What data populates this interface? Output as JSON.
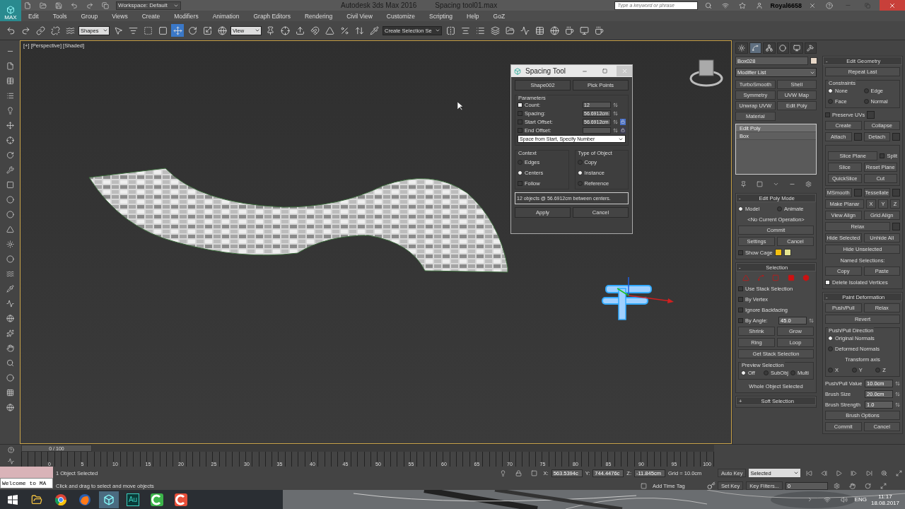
{
  "title_bar": {
    "app_label": "MAX",
    "workspace": "Workspace: Default",
    "title": "Autodesk 3ds Max 2016",
    "file": "Spacing tool01.max",
    "search_placeholder": "Type a keyword or phrase",
    "user": "Royal6658"
  },
  "menu": [
    "Edit",
    "Tools",
    "Group",
    "Views",
    "Create",
    "Modifiers",
    "Animation",
    "Graph Editors",
    "Rendering",
    "Civil View",
    "Customize",
    "Scripting",
    "Help",
    "GoZ"
  ],
  "toolbar": {
    "selection_filter": "Shapes",
    "reference_coordinate": "View",
    "named_selection": "Create Selection Se"
  },
  "viewport": {
    "label": "[+] [Perspective] [Shaded]",
    "active": true,
    "dialog": {
      "title": "Spacing Tool",
      "path_button": "Shape002",
      "points_button": "Pick Points",
      "parameters_title": "Parameters",
      "parameters": [
        {
          "kind": "spinner",
          "label": "Count:",
          "checked": true,
          "value": "12"
        },
        {
          "kind": "spinner",
          "label": "Spacing:",
          "checked": false,
          "value": "56.6912cm"
        },
        {
          "kind": "locked",
          "label": "Start Offset:",
          "checked": false,
          "value": "56.6912cm",
          "lock_on": true
        },
        {
          "kind": "locked",
          "label": "End Offset:",
          "checked": false,
          "lock_on": false
        }
      ],
      "mode": "Space from Start, Specify Number",
      "context_title": "Context",
      "context": [
        {
          "label": "Edges",
          "selected": false
        },
        {
          "label": "Centers",
          "selected": true
        }
      ],
      "follow": {
        "label": "Follow",
        "checked": false
      },
      "type_title": "Type of Object",
      "types": [
        {
          "label": "Copy",
          "selected": false
        },
        {
          "label": "Instance",
          "selected": true
        },
        {
          "label": "Reference",
          "selected": false
        }
      ],
      "summary": "12 objects @ 56.6912cm  between centers.",
      "apply": "Apply",
      "cancel": "Cancel"
    }
  },
  "panel": {
    "tabs": [
      {
        "selected": false
      },
      {
        "selected": true
      },
      {
        "selected": false
      },
      {
        "selected": false
      },
      {
        "selected": false
      },
      {
        "selected": false
      }
    ],
    "object_name": "Box028",
    "modifier_list": "Modifier List",
    "modifier_buttons": [
      "TurboSmooth",
      "Shell",
      "Symmetry",
      "UVW Map",
      "Unwrap UVW",
      "Edit Poly",
      "Material"
    ],
    "stack": [
      {
        "label": "Edit Poly",
        "selected": true
      },
      {
        "label": "Box",
        "selected": false
      }
    ],
    "rollouts_left": [
      {
        "sign": "-",
        "title": "Edit Poly Mode",
        "rows": [
          [
            {
              "kind": "radio",
              "label": "Model",
              "selected": true
            },
            {
              "kind": "radio",
              "label": "Animate",
              "selected": false
            }
          ],
          [
            {
              "kind": "text",
              "label": "<No Current Operation>"
            }
          ],
          [
            {
              "kind": "button",
              "label": "Commit"
            }
          ],
          [
            {
              "kind": "button",
              "label": "Settings"
            },
            {
              "kind": "button",
              "label": "Cancel"
            }
          ],
          [
            {
              "kind": "checkbox",
              "label": "Show Cage",
              "checked": false
            },
            {
              "kind": "swatch",
              "color": "#f5c010"
            },
            {
              "kind": "swatch",
              "color": "#e4e490"
            }
          ]
        ]
      },
      {
        "sign": "-",
        "title": "Selection",
        "rows": [
          [
            {
              "kind": "icons"
            }
          ],
          [
            {
              "kind": "checkbox",
              "label": "Use Stack Selection",
              "checked": false
            }
          ],
          [
            {
              "kind": "checkbox",
              "label": "By Vertex",
              "checked": false
            }
          ],
          [
            {
              "kind": "checkbox",
              "label": "Ignore Backfacing",
              "checked": false
            }
          ],
          [
            {
              "kind": "checkbox",
              "label": "By Angle:",
              "checked": false
            },
            {
              "kind": "spinner",
              "value": "45.0"
            }
          ],
          [
            {
              "kind": "button",
              "label": "Shrink"
            },
            {
              "kind": "button",
              "label": "Grow"
            }
          ],
          [
            {
              "kind": "button",
              "label": "Ring"
            },
            {
              "kind": "button",
              "label": "Loop"
            }
          ],
          [
            {
              "kind": "button",
              "label": "Get Stack Selection"
            }
          ],
          [
            {
              "kind": "group",
              "title": "Preview Selection",
              "rows": [
                [
                  {
                    "kind": "radio",
                    "label": "Off",
                    "selected": true
                  },
                  {
                    "kind": "radio",
                    "label": "SubObj",
                    "selected": false
                  },
                  {
                    "kind": "radio",
                    "label": "Multi",
                    "selected": false
                  }
                ]
              ]
            }
          ],
          [
            {
              "kind": "text",
              "label": "Whole Object Selected"
            }
          ]
        ]
      },
      {
        "sign": "+",
        "title": "Soft Selection"
      }
    ],
    "rollouts_right": [
      {
        "sign": "-",
        "title": "Edit Geometry",
        "rows": [
          [
            {
              "kind": "button",
              "label": "Repeat Last"
            }
          ],
          [
            {
              "kind": "group",
              "title": "Constraints",
              "rows": [
                [
                  {
                    "kind": "radio",
                    "label": "None",
                    "selected": true
                  },
                  {
                    "kind": "radio",
                    "label": "Edge",
                    "selected": false
                  }
                ],
                [
                  {
                    "kind": "radio",
                    "label": "Face",
                    "selected": false
                  },
                  {
                    "kind": "radio",
                    "label": "Normal",
                    "selected": false
                  }
                ]
              ]
            }
          ],
          [
            {
              "kind": "checkbox",
              "label": "Preserve UVs",
              "checked": false,
              "settings": true
            }
          ],
          [
            {
              "kind": "button",
              "label": "Create"
            },
            {
              "kind": "button",
              "label": "Collapse"
            }
          ],
          [
            {
              "kind": "button",
              "label": "Attach",
              "settings": true
            },
            {
              "kind": "button",
              "label": "Detach",
              "settings": true
            }
          ],
          [
            {
              "kind": "group",
              "rows": [
                [
                  {
                    "kind": "button",
                    "label": "Slice Plane"
                  },
                  {
                    "kind": "checkbox",
                    "label": "Split",
                    "checked": false
                  }
                ],
                [
                  {
                    "kind": "button",
                    "label": "Slice"
                  },
                  {
                    "kind": "button",
                    "label": "Reset Plane"
                  }
                ],
                [
                  {
                    "kind": "button",
                    "label": "QuickSlice"
                  },
                  {
                    "kind": "button",
                    "label": "Cut"
                  }
                ]
              ]
            }
          ],
          [
            {
              "kind": "button",
              "label": "MSmooth",
              "settings": true
            },
            {
              "kind": "button",
              "label": "Tessellate",
              "settings": true
            }
          ],
          [
            {
              "kind": "button",
              "label": "Make Planar"
            },
            {
              "kind": "small",
              "label": "X"
            },
            {
              "kind": "small",
              "label": "Y"
            },
            {
              "kind": "small",
              "label": "Z"
            }
          ],
          [
            {
              "kind": "button",
              "label": "View Align"
            },
            {
              "kind": "button",
              "label": "Grid Align"
            }
          ],
          [
            {
              "kind": "button",
              "label": "Relax",
              "settings": true
            }
          ],
          [
            {
              "kind": "button",
              "label": "Hide Selected"
            },
            {
              "kind": "button",
              "label": "Unhide All"
            }
          ],
          [
            {
              "kind": "button",
              "label": "Hide Unselected"
            }
          ],
          [
            {
              "kind": "text",
              "label": "Named Selections:"
            }
          ],
          [
            {
              "kind": "button",
              "label": "Copy"
            },
            {
              "kind": "button",
              "label": "Paste"
            }
          ],
          [
            {
              "kind": "checkbox",
              "label": "Delete Isolated Vertices",
              "checked": true
            }
          ]
        ]
      },
      {
        "sign": "-",
        "title": "Paint Deformation",
        "rows": [
          [
            {
              "kind": "button",
              "label": "Push/Pull"
            },
            {
              "kind": "button",
              "label": "Relax"
            }
          ],
          [
            {
              "kind": "button",
              "label": "Revert"
            }
          ],
          [
            {
              "kind": "group",
              "title": "Push/Pull Direction",
              "rows": [
                [
                  {
                    "kind": "radio",
                    "label": "Original Normals",
                    "selected": true
                  }
                ],
                [
                  {
                    "kind": "radio",
                    "label": "Deformed Normals",
                    "selected": false
                  }
                ],
                [
                  {
                    "kind": "text",
                    "label": "Transform axis"
                  }
                ],
                [
                  {
                    "kind": "radio",
                    "label": "X",
                    "selected": false
                  },
                  {
                    "kind": "radio",
                    "label": "Y",
                    "selected": false
                  },
                  {
                    "kind": "radio",
                    "label": "Z",
                    "selected": false
                  }
                ]
              ]
            }
          ],
          [
            {
              "kind": "spinner",
              "label": "Push/Pull Value",
              "value": "10.0cm"
            }
          ],
          [
            {
              "kind": "spinner",
              "label": "Brush Size",
              "value": "20.0cm"
            }
          ],
          [
            {
              "kind": "spinner",
              "label": "Brush Strength",
              "value": "1.0"
            }
          ],
          [
            {
              "kind": "button",
              "label": "Brush Options"
            }
          ],
          [
            {
              "kind": "button",
              "label": "Commit"
            },
            {
              "kind": "button",
              "label": "Cancel"
            }
          ]
        ]
      }
    ]
  },
  "timeline": {
    "position": "0 / 100",
    "level": 0,
    "ticks": [
      "0",
      "5",
      "10",
      "15",
      "20",
      "25",
      "30",
      "35",
      "40",
      "45",
      "50",
      "55",
      "60",
      "65",
      "70",
      "75",
      "80",
      "85",
      "90",
      "95",
      "100"
    ]
  },
  "status_bar": {
    "listener": "Welcome to MA",
    "selected_count": "1 Object Selected",
    "prompt": "Click and drag to select and move objects",
    "x_label": "X:",
    "x": "563.5394c",
    "y_label": "Y:",
    "y": "744.4476c",
    "z_label": "Z:",
    "z": "-11.845cm",
    "grid": "Grid = 10.0cm",
    "time_tag": "Add Time Tag",
    "auto_key": "Auto Key",
    "key_mode": "Selected",
    "set_key": "Set Key",
    "key_filters": "Key Filters...",
    "frame": "0"
  },
  "taskbar": {
    "audition_label": "Au",
    "language": "ENG",
    "time": "11:17",
    "date": "18.08.2017"
  }
}
